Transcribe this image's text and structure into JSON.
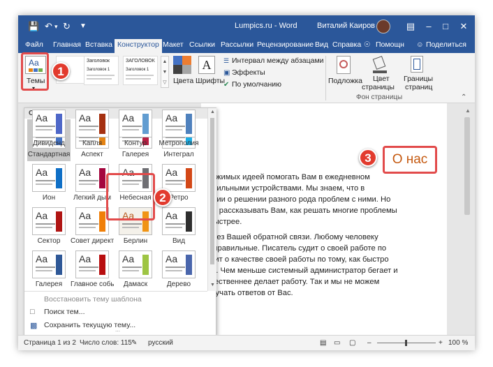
{
  "window": {
    "title": "Lumpics.ru  -  Word",
    "user": "Виталий Каиров",
    "file_tab": "Файл",
    "tabs": [
      "Главная",
      "Вставка",
      "Конструктор",
      "Макет",
      "Ссылки",
      "Рассылки",
      "Рецензирование",
      "Вид",
      "Справка"
    ],
    "help_label": "Помощн",
    "share_label": "Поделиться"
  },
  "ribbon": {
    "themes_label": "Темы",
    "colors_label": "Цвета",
    "fonts_label": "Шрифты",
    "paragraph_spacing": "Интервал между абзацами",
    "effects": "Эффекты",
    "default": "По умолчанию",
    "watermark": "Подложка",
    "page_color": [
      "Цвет",
      "страницы"
    ],
    "page_borders": [
      "Границы",
      "страниц"
    ],
    "page_background_group": "Фон страницы",
    "style_preview_headings": [
      "Заголовок",
      "Заголовок 1",
      "ЗАГОЛОВОК",
      "Заголовок 1"
    ]
  },
  "gallery": {
    "header": "Office",
    "themes": [
      {
        "name": "Стандартная",
        "bar": "#4472c4",
        "selected": true
      },
      {
        "name": "Аспект",
        "bar": "#e48312"
      },
      {
        "name": "Галерея",
        "bar": "#b71e42"
      },
      {
        "name": "Интеграл",
        "bar": "#1cade4"
      },
      {
        "name": "Ион",
        "bar": "#0f6fc6"
      },
      {
        "name": "Легкий дым",
        "bar": "#a4063e"
      },
      {
        "name": "Небесная",
        "bar": "#6f6f74"
      },
      {
        "name": "Ретро",
        "bar": "#d34817"
      },
      {
        "name": "Сектор",
        "bar": "#b01513"
      },
      {
        "name": "Совет директоров",
        "bar": "#f07f09"
      },
      {
        "name": "Берлин",
        "bar": "#f09415",
        "highlighted": true
      },
      {
        "name": "Вид",
        "bar": "#2e2e2e"
      },
      {
        "name": "Галерея",
        "bar": "#2f5897"
      },
      {
        "name": "Главное событие",
        "bar": "#b80e0f"
      },
      {
        "name": "Дамаск",
        "bar": "#9ec544"
      },
      {
        "name": "Дерево",
        "bar": "#4a66ac"
      },
      {
        "name": "Дивиденд",
        "bar": "#4e67c8"
      },
      {
        "name": "Капля",
        "bar": "#a53010"
      },
      {
        "name": "Контур",
        "bar": "#629dd1"
      },
      {
        "name": "Метрополия",
        "bar": "#4f81bd"
      }
    ],
    "menu": [
      "Восстановить тему шаблона",
      "Поиск тем...",
      "Сохранить текущую тему..."
    ]
  },
  "document": {
    "heading": "О нас",
    "lines": [
      "держимых идеей помогать Вам в ежедневном",
      "мобильными устройствами. Мы знаем, что в",
      "мации о решении разного рода проблем с ними. Но",
      "обы рассказывать Вам, как решать многие проблемы",
      "и быстрее.",
      "ть без Вашей обратной связи. Любому человеку",
      "ия правильные. Писатель судит о своей работе по",
      "судит о качестве своей работы по тому, как быстро",
      "нты. Чем меньше системный администратор бегает и",
      "качественнее делает работу. Так и мы не можем",
      "получать ответов от Вас."
    ]
  },
  "status": {
    "page": "Страница 1 из 2",
    "words": "Число слов: 115",
    "language": "русский",
    "zoom": "100 %"
  },
  "callouts": [
    "1",
    "2",
    "3"
  ],
  "colors": {
    "word_blue": "#2b579a",
    "callout_red": "#e23b2e",
    "heading_orange": "#c55a11"
  }
}
